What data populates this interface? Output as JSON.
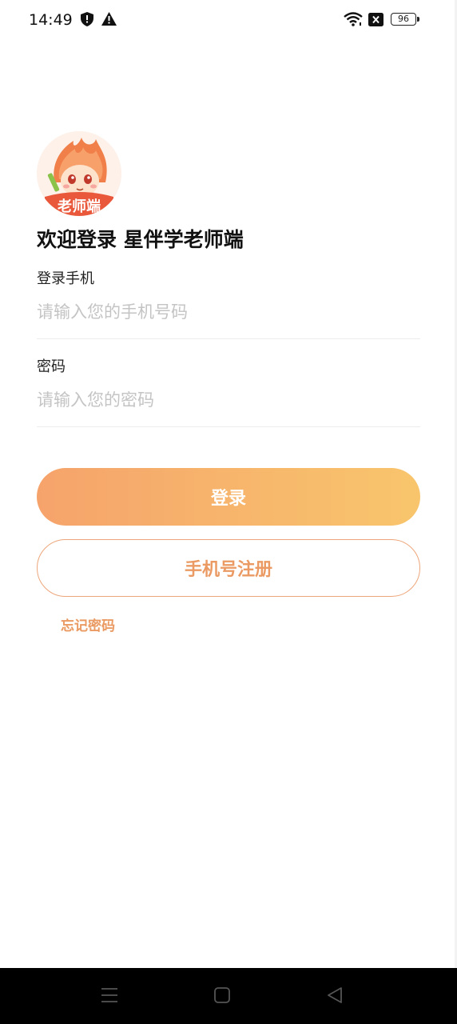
{
  "status_bar": {
    "time": "14:49",
    "battery": "96",
    "icons": [
      "shield-icon",
      "warning-icon",
      "wifi-icon",
      "sim-blocked-icon",
      "battery-icon"
    ]
  },
  "app": {
    "avatar_text": "老师端",
    "welcome_title": "欢迎登录 星伴学老师端"
  },
  "form": {
    "phone_label": "登录手机",
    "phone_placeholder": "请输入您的手机号码",
    "phone_value": "",
    "password_label": "密码",
    "password_placeholder": "请输入您的密码",
    "password_value": ""
  },
  "actions": {
    "login_label": "登录",
    "register_label": "手机号注册",
    "forgot_label": "忘记密码"
  },
  "colors": {
    "accent": "#ea9a62",
    "gradient_start": "#f6a36b",
    "gradient_end": "#f8c56c"
  },
  "nav_bar": {
    "icons": [
      "menu-icon",
      "home-icon",
      "back-icon"
    ]
  }
}
